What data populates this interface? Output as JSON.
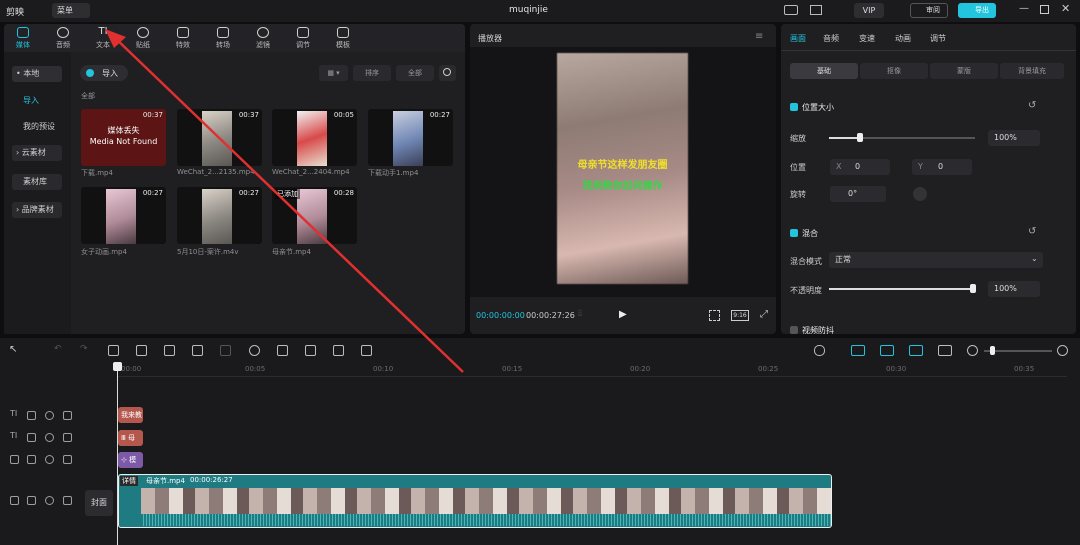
{
  "app": {
    "logo": "剪映",
    "menu": "菜单",
    "title": "muqinjie",
    "vip": "VIP",
    "review": "审阅",
    "export": "导出"
  },
  "media_tabs": [
    "媒体",
    "音频",
    "文本",
    "贴纸",
    "特效",
    "转场",
    "滤镜",
    "调节",
    "模板"
  ],
  "sidebar": {
    "local": "• 本地",
    "import": "导入",
    "presets": "我的预设",
    "cloud": "› 云素材",
    "library": "素材库",
    "brand": "› 品牌素材"
  },
  "library": {
    "import_btn": "导入",
    "sort": "排序",
    "all_filter": "全部",
    "all_label": "全部"
  },
  "media": [
    {
      "dur": "00:37",
      "name": "下载.mp4",
      "missing": "媒体丢失\nMedia Not Found"
    },
    {
      "dur": "00:37",
      "name": "WeChat_2...2135.mp4"
    },
    {
      "dur": "00:05",
      "name": "WeChat_2...2404.mp4"
    },
    {
      "dur": "00:27",
      "name": "下载动手1.mp4"
    },
    {
      "dur": "00:27",
      "name": "女子动画.mp4"
    },
    {
      "dur": "00:27",
      "name": "5月10日-案许.m4v"
    },
    {
      "dur": "00:28",
      "name": "母亲节.mp4",
      "added": "已添加"
    }
  ],
  "player": {
    "title": "播放器",
    "overlay1": "母亲节这样发朋友圈",
    "overlay2": "我来教你如何操作",
    "current": "00:00:00:00",
    "total": "00:00:27:26",
    "ratio": "9:16"
  },
  "inspector": {
    "tabs": [
      "画面",
      "音频",
      "变速",
      "动画",
      "调节"
    ],
    "subtabs": [
      "基础",
      "抠像",
      "蒙版",
      "背景填充"
    ],
    "pos_size": "位置大小",
    "scale_label": "缩放",
    "scale_value": "100%",
    "position_label": "位置",
    "x_label": "X",
    "x_value": "0",
    "y_label": "Y",
    "y_value": "0",
    "rotate_label": "旋转",
    "rotate_value": "0°",
    "blend": "混合",
    "blend_mode_label": "混合模式",
    "blend_mode_value": "正常",
    "opacity_label": "不透明度",
    "opacity_value": "100%",
    "stabilize": "视频防抖"
  },
  "timeline": {
    "ticks": [
      "00:00",
      "00:05",
      "00:10",
      "00:15",
      "00:20",
      "00:25",
      "00:30",
      "00:35"
    ],
    "text_clip1": "我来教",
    "text_clip2": "Ⅲ 母",
    "effect_clip": "⊹ 模",
    "main_label": "详情",
    "main_name": "母亲节.mp4",
    "main_dur": "00:00:26:27",
    "cover": "封面"
  },
  "colors": {
    "accent": "#22c5dd",
    "arrow": "#e03030",
    "text_clip": "#b4584e",
    "effect_clip": "#7d5aa8",
    "video_clip": "#1e7b82"
  }
}
